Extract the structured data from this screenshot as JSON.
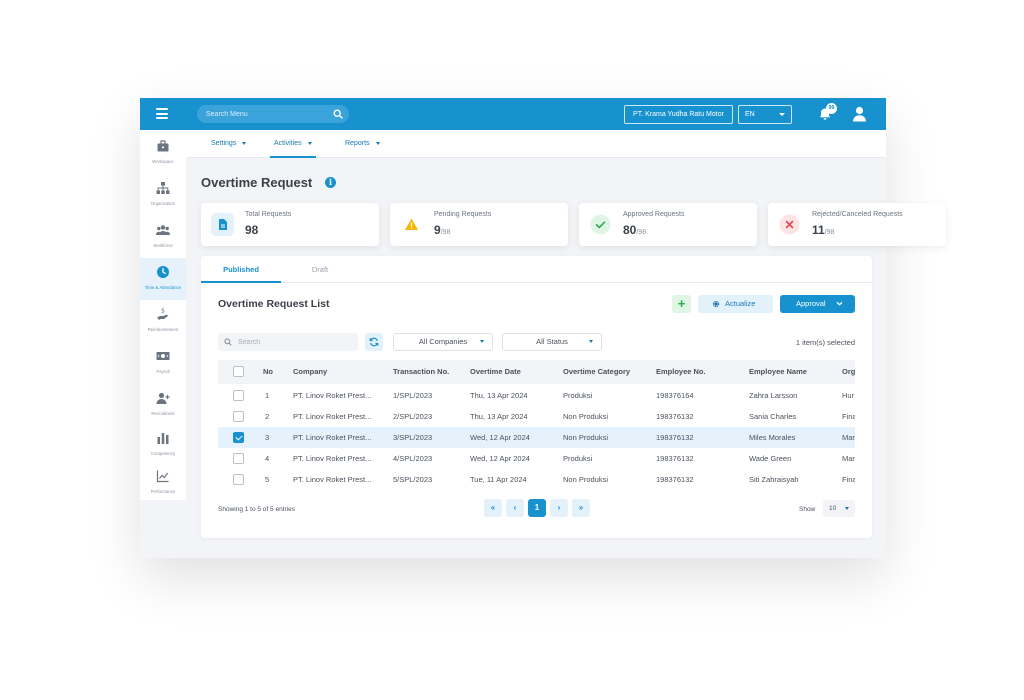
{
  "topbar": {
    "search_placeholder": "Search Menu",
    "company": "PT. Krama Yudha Ratu Motor",
    "language": "EN",
    "notification_count": "99"
  },
  "sidebar": {
    "items": [
      {
        "label": "Workspace",
        "icon": "briefcase-icon"
      },
      {
        "label": "Organization",
        "icon": "org-chart-icon"
      },
      {
        "label": "Workforce",
        "icon": "users-icon"
      },
      {
        "label": "Time & Attendance",
        "icon": "clock-icon"
      },
      {
        "label": "Reimbursement",
        "icon": "hand-money-icon"
      },
      {
        "label": "Payroll",
        "icon": "banknote-icon"
      },
      {
        "label": "Recruitment",
        "icon": "user-plus-icon"
      },
      {
        "label": "Competency",
        "icon": "bar-chart-icon"
      },
      {
        "label": "Performance",
        "icon": "trend-chart-icon"
      }
    ]
  },
  "nav": {
    "tabs": [
      {
        "label": "Settings"
      },
      {
        "label": "Activities"
      },
      {
        "label": "Reports"
      }
    ]
  },
  "page": {
    "title": "Overtime Request"
  },
  "stats": [
    {
      "label": "Total Requests",
      "value": "98",
      "total": ""
    },
    {
      "label": "Pending Requests",
      "value": "9",
      "total": "/98"
    },
    {
      "label": "Approved Requests",
      "value": "80",
      "total": "/98"
    },
    {
      "label": "Rejected/Canceled Requests",
      "value": "11",
      "total": "/98"
    }
  ],
  "main": {
    "tabs": [
      {
        "label": "Published"
      },
      {
        "label": "Draft"
      }
    ],
    "list_title": "Overtime Request List",
    "add_label": "+",
    "actualize_label": "Actualize",
    "approval_label": "Approval",
    "search_placeholder": "Search",
    "filter_company": "All Companies",
    "filter_status": "All Status",
    "selected_text": "1 item(s) selected"
  },
  "table": {
    "columns": [
      "No",
      "Company",
      "Transaction No.",
      "Overtime Date",
      "Overtime Category",
      "Employee No.",
      "Employee Name",
      "Org"
    ],
    "rows": [
      {
        "no": "1",
        "company": "PT. Linov Roket Prest...",
        "transaction": "1/SPL/2023",
        "date": "Thu, 13 Apr 2024",
        "category": "Produksi",
        "emp_no": "198376164",
        "emp_name": "Zahra Larsson",
        "org": "Hur"
      },
      {
        "no": "2",
        "company": "PT. Linov Roket Prest...",
        "transaction": "2/SPL/2023",
        "date": "Thu, 13 Apr 2024",
        "category": "Non Produksi",
        "emp_no": "198376132",
        "emp_name": "Sania Charles",
        "org": "Fina"
      },
      {
        "no": "3",
        "company": "PT. Linov Roket Prest...",
        "transaction": "3/SPL/2023",
        "date": "Wed, 12 Apr 2024",
        "category": "Non Produksi",
        "emp_no": "198376132",
        "emp_name": "Miles Morales",
        "org": "Mar"
      },
      {
        "no": "4",
        "company": "PT. Linov Roket Prest...",
        "transaction": "4/SPL/2023",
        "date": "Wed, 12 Apr 2024",
        "category": "Produksi",
        "emp_no": "198376132",
        "emp_name": "Wade Green",
        "org": "Mar"
      },
      {
        "no": "5",
        "company": "PT. Linov Roket Prest...",
        "transaction": "5/SPL/2023",
        "date": "Tue, 11 Apr 2024",
        "category": "Non Produksi",
        "emp_no": "198376132",
        "emp_name": "Siti Zahraisyah",
        "org": "Fina"
      }
    ],
    "selected_row": "3"
  },
  "footer": {
    "showing": "Showing 1 to 5 of 5 entries",
    "pager": {
      "first": "«",
      "prev": "‹",
      "current": "1",
      "next": "›",
      "last": "»"
    },
    "show_label": "Show",
    "page_size": "10"
  },
  "colors": {
    "primary": "#1891cf",
    "success": "#2eaa4f",
    "warning": "#f5b800",
    "danger": "#e5484d"
  }
}
